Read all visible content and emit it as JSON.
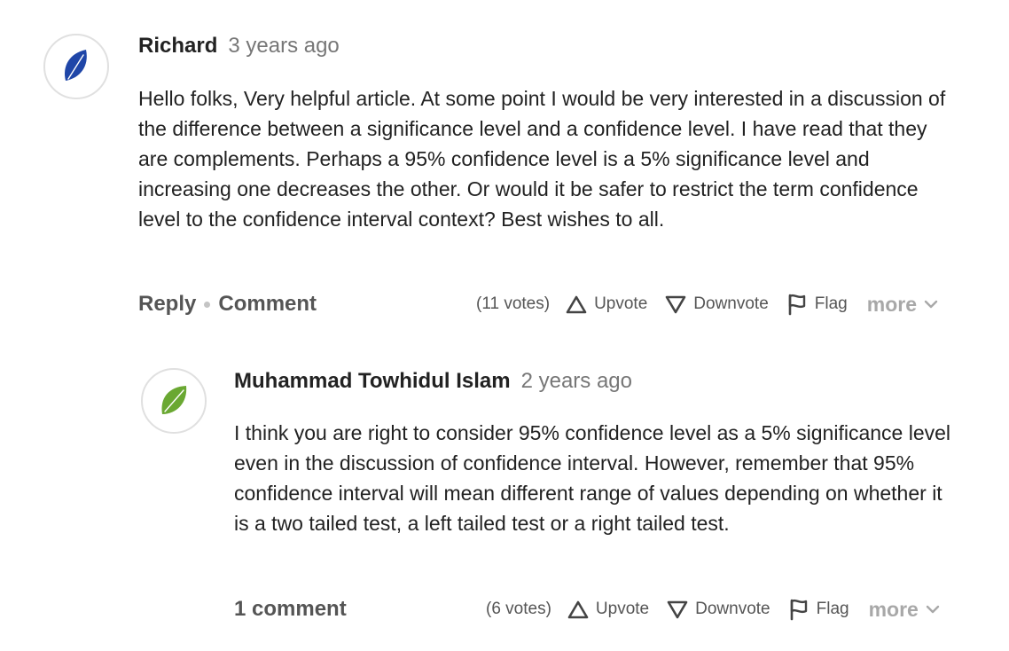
{
  "comments": [
    {
      "author": "Richard",
      "time": "3 years ago",
      "avatar_color": "#1f46a8",
      "body": "Hello folks, Very helpful article. At some point I would be very interested in a discussion of the difference between a significance level and a confidence level. I have read that they are complements. Perhaps a 95% confidence level is a 5% significance level and increasing one decreases the other. Or would it be safer to restrict the term confidence level to the confidence interval context? Best wishes to all.",
      "reply_label": "Reply",
      "comment_label": "Comment",
      "votes": "(11 votes)",
      "upvote": "Upvote",
      "downvote": "Downvote",
      "flag": "Flag",
      "more": "more"
    },
    {
      "author": "Muhammad Towhidul Islam",
      "time": "2 years ago",
      "avatar_color": "#6aa832",
      "body": "I think you are right to consider 95% confidence level as a 5% significance level even in the discussion of confidence interval. However, remember that 95% confidence interval will mean different range of values depending on whether it is a two tailed test, a left tailed test or a right tailed test.",
      "comments_label": "1 comment",
      "votes": "(6 votes)",
      "upvote": "Upvote",
      "downvote": "Downvote",
      "flag": "Flag",
      "more": "more"
    }
  ],
  "icons": {
    "avatar": "leaf-icon",
    "upvote": "triangle-up-icon",
    "downvote": "triangle-down-icon",
    "flag": "flag-icon",
    "more": "chevron-down-icon"
  }
}
